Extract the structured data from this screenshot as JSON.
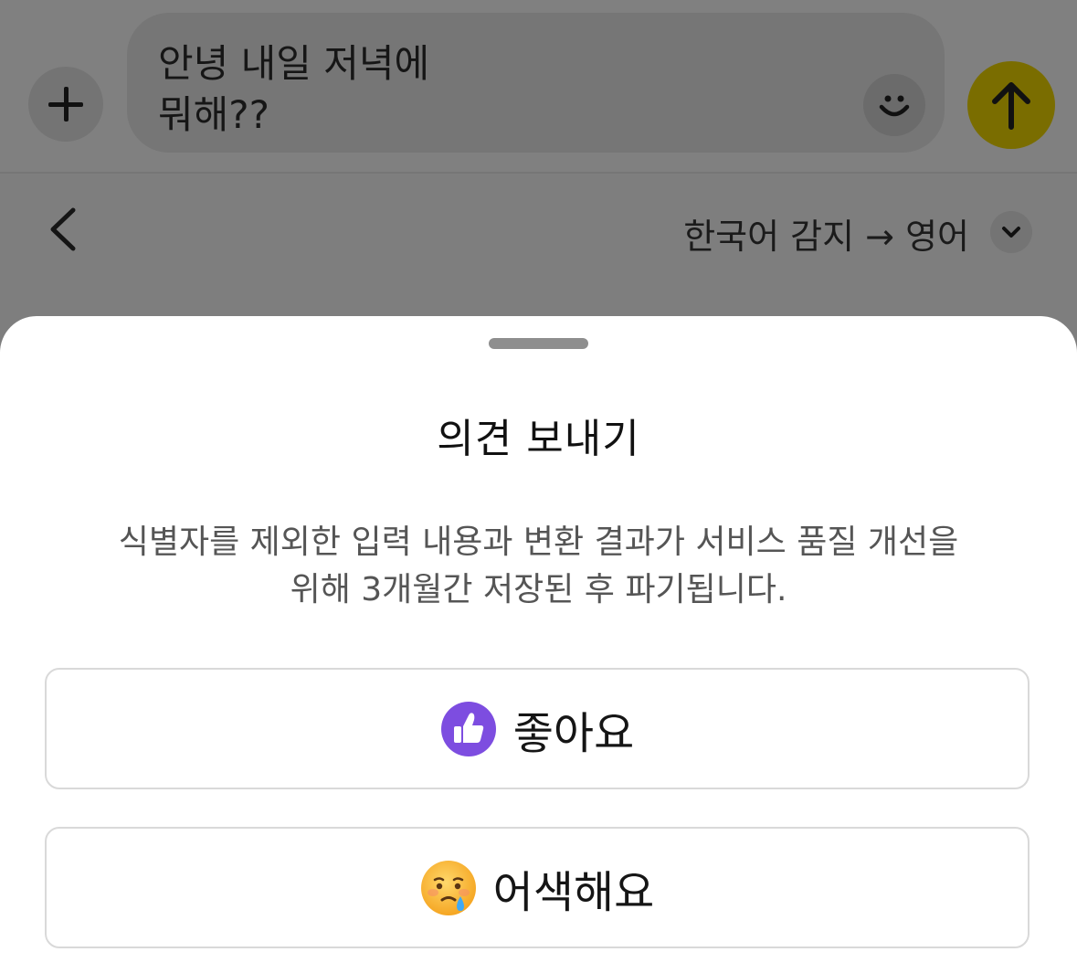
{
  "composer": {
    "message_text": "안녕 내일 저녁에\n뭐해??",
    "icons": {
      "attach": "plus-icon",
      "emoji": "smiley-icon",
      "send": "arrow-up-icon"
    },
    "send_color": "#7a6d00"
  },
  "translation_bar": {
    "language_label": "한국어 감지 → 영어",
    "icons": {
      "back": "chevron-left-icon",
      "language_menu": "chevron-down-icon"
    }
  },
  "feedback_sheet": {
    "title": "의견 보내기",
    "description": "식별자를 제외한 입력 내용과 변환 결과가 서비스 품질 개선을\n위해 3개월간 저장된 후 파기됩니다.",
    "options": [
      {
        "label": "좋아요",
        "icon": "thumbs-up-icon",
        "icon_color": "#7d4de0"
      },
      {
        "label": "어색해요",
        "icon": "sad-tear-face-icon",
        "icon_color": "#f7b733"
      }
    ]
  }
}
